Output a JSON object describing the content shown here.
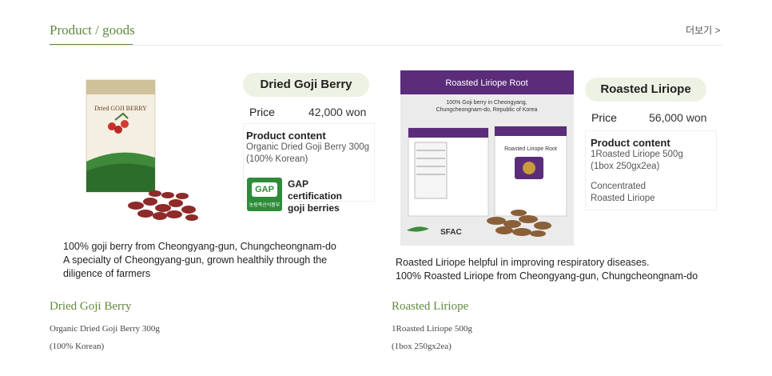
{
  "section": {
    "title": "Product / goods",
    "more_label": "더보기 >"
  },
  "left": {
    "pill": "Dried Goji Berry",
    "price_label": "Price",
    "price_value": "42,000 won",
    "content_title": "Product content",
    "content_lines": [
      "Organic Dried Goji Berry 300g",
      "(100% Korean)"
    ],
    "gap_badge_text": "GAP",
    "gap_lines": [
      "GAP",
      "certification",
      "goji berries"
    ],
    "package_title": "Dried GOJI BERRY",
    "captions": [
      "100% goji berry from Cheongyang-gun, Chungcheongnam-do",
      "A specialty of Cheongyang-gun, grown healthily through the",
      "diligence of farmers"
    ],
    "name": "Dried Goji Berry",
    "desc": [
      "Organic Dried Goji Berry 300g",
      "(100% Korean)"
    ]
  },
  "right": {
    "pill": "Roasted Liriope",
    "price_label": "Price",
    "price_value": "56,000 won",
    "content_title": "Product content",
    "content_lines": [
      "1Roasted Liriope 500g",
      "(1box 250gx2ea)",
      "",
      "Concentrated",
      "Roasted Liriope"
    ],
    "photo_header": "Roasted Liriope Root",
    "photo_sub": [
      "100% Goji berry in Cheongyang,",
      "Chungcheongnam-do, Republic of Korea"
    ],
    "photo_box_label": "Roasted Liriope Root",
    "photo_logo": "SFAC",
    "captions": [
      "Roasted Liriope helpful in improving respiratory diseases.",
      "100% Roasted Liriope from Cheongyang-gun, Chungcheongnam-do"
    ],
    "name": "Roasted Liriope",
    "desc": [
      "1Roasted Liriope 500g",
      "(1box 250gx2ea)"
    ]
  },
  "colors": {
    "accent": "#5f8a3c",
    "pill_bg": "#eef2e4",
    "gap_green": "#2e8b3a",
    "purple": "#5b2c7a"
  }
}
